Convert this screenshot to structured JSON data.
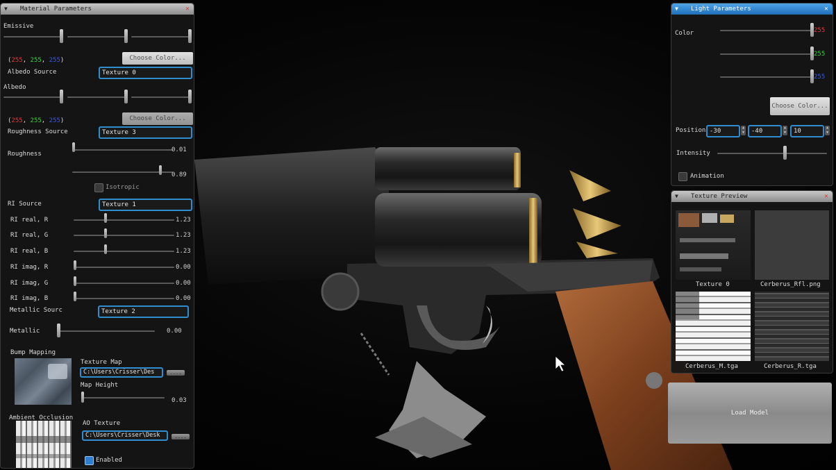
{
  "material_panel": {
    "title": "Material Parameters",
    "emissive_label": "Emissive",
    "emissive_rgb": {
      "r": "255",
      "g": "255",
      "b": "255"
    },
    "choose_color": "Choose Color...",
    "albedo_source_label": "Albedo Source",
    "albedo_source_value": "Texture 0",
    "albedo_label": "Albedo",
    "albedo_rgb": {
      "r": "255",
      "g": "255",
      "b": "255"
    },
    "roughness_source_label": "Roughness Source",
    "roughness_source_value": "Texture 3",
    "roughness_label": "Roughness",
    "roughness_values": [
      "0.01",
      "0.89"
    ],
    "isotropic_label": "Isotropic",
    "ri_source_label": "RI Source",
    "ri_source_value": "Texture 1",
    "ri_rows": [
      {
        "label": "RI real, R",
        "value": "1.23"
      },
      {
        "label": "RI real, G",
        "value": "1.23"
      },
      {
        "label": "RI real, B",
        "value": "1.23"
      },
      {
        "label": "RI imag, R",
        "value": "0.00"
      },
      {
        "label": "RI imag, G",
        "value": "0.00"
      },
      {
        "label": "RI imag, B",
        "value": "0.00"
      }
    ],
    "metallic_source_label": "Metallic Sourc",
    "metallic_source_value": "Texture 2",
    "metallic_label": "Metallic",
    "metallic_value": "0.00",
    "bump_mapping_label": "Bump Mapping",
    "texture_map_label": "Texture Map",
    "texture_map_path": "C:\\Users\\Crisser\\Des",
    "map_height_label": "Map Height",
    "map_height_value": "0.03",
    "ambient_occlusion_label": "Ambient Occlusion",
    "ao_texture_label": "AO Texture",
    "ao_texture_path": "C:\\Users\\Crisser\\Desk",
    "enabled_label": "Enabled",
    "browse_label": "...."
  },
  "light_panel": {
    "title": "Light Parameters",
    "color_label": "Color",
    "color_values": {
      "r": "255",
      "g": "255",
      "b": "255"
    },
    "choose_color": "Choose Color...",
    "position_label": "Position",
    "position_values": [
      "-30",
      "-40",
      "10"
    ],
    "intensity_label": "Intensity",
    "animation_label": "Animation"
  },
  "texture_panel": {
    "title": "Texture Preview",
    "textures": [
      "Texture 0",
      "Cerberus_Rfl.png",
      "Cerberus_M.tga",
      "Cerberus_R.tga"
    ]
  },
  "load_model_label": "Load Model",
  "colors": {
    "accent": "#2f8dd0",
    "red": "#e23a3a",
    "green": "#3ad23a",
    "blue": "#3a5ae2"
  }
}
